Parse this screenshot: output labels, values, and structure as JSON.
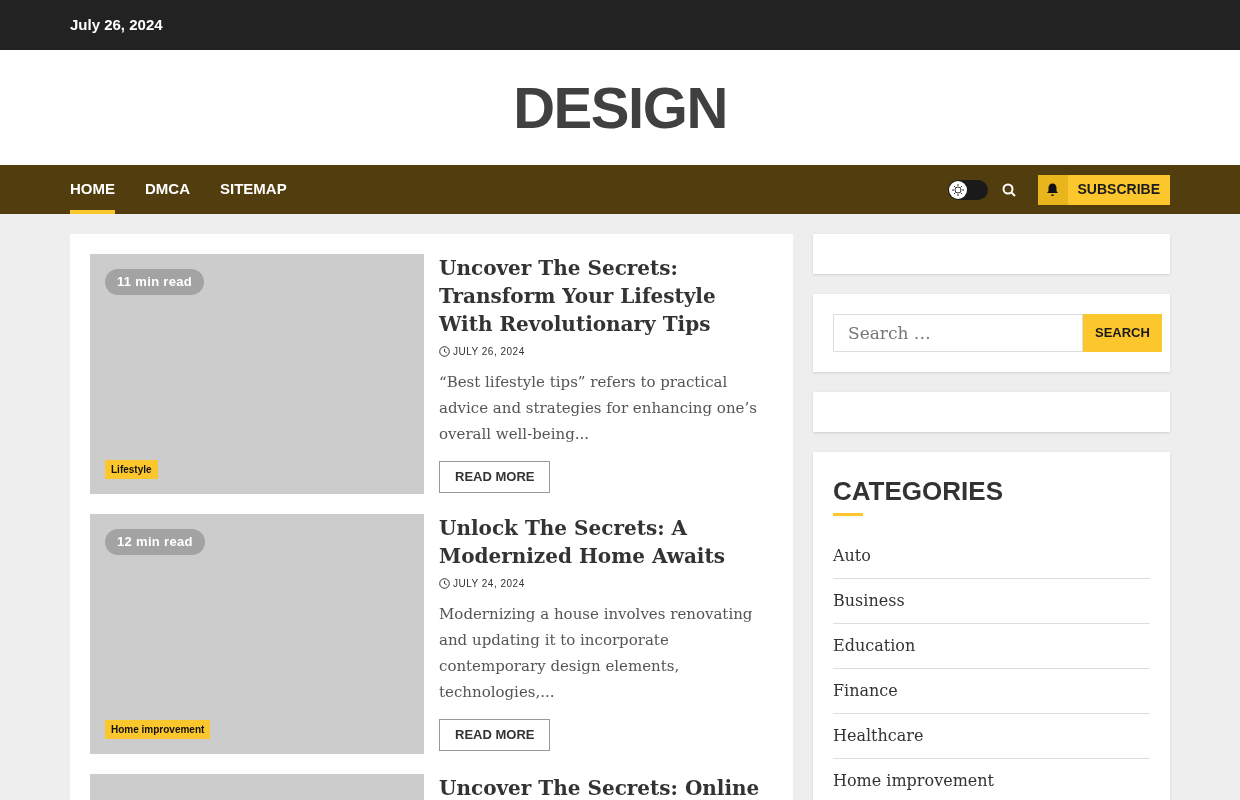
{
  "top_bar": {
    "date": "July 26, 2024"
  },
  "site_title": "DESIGN",
  "nav": {
    "items": [
      {
        "label": "HOME",
        "selected": true
      },
      {
        "label": "DMCA",
        "selected": false
      },
      {
        "label": "SITEMAP",
        "selected": false
      }
    ],
    "dark_mode": false,
    "subscribe": "SUBSCRIBE"
  },
  "posts": [
    {
      "read_time": "11 min read",
      "category": "Lifestyle",
      "title": "Uncover The Secrets: Transform Your Lifestyle With Revolutionary Tips",
      "date": "JULY 26, 2024",
      "excerpt": "“Best lifestyle tips” refers to practical advice and strategies for enhancing one’s overall well-being...",
      "button": "READ MORE"
    },
    {
      "read_time": "12 min read",
      "category": "Home improvement",
      "title": "Unlock The Secrets: A Modernized Home Awaits",
      "date": "JULY 24, 2024",
      "excerpt": "Modernizing a house involves renovating and updating it to incorporate contemporary design elements, technologies,...",
      "button": "READ MORE"
    },
    {
      "title": "Uncover The Secrets: Online"
    }
  ],
  "sidebar": {
    "search": {
      "placeholder": "Search …",
      "button": "SEARCH"
    },
    "categories": {
      "heading": "CATEGORIES",
      "items": [
        "Auto",
        "Business",
        "Education",
        "Finance",
        "Healthcare",
        "Home improvement"
      ]
    }
  }
}
